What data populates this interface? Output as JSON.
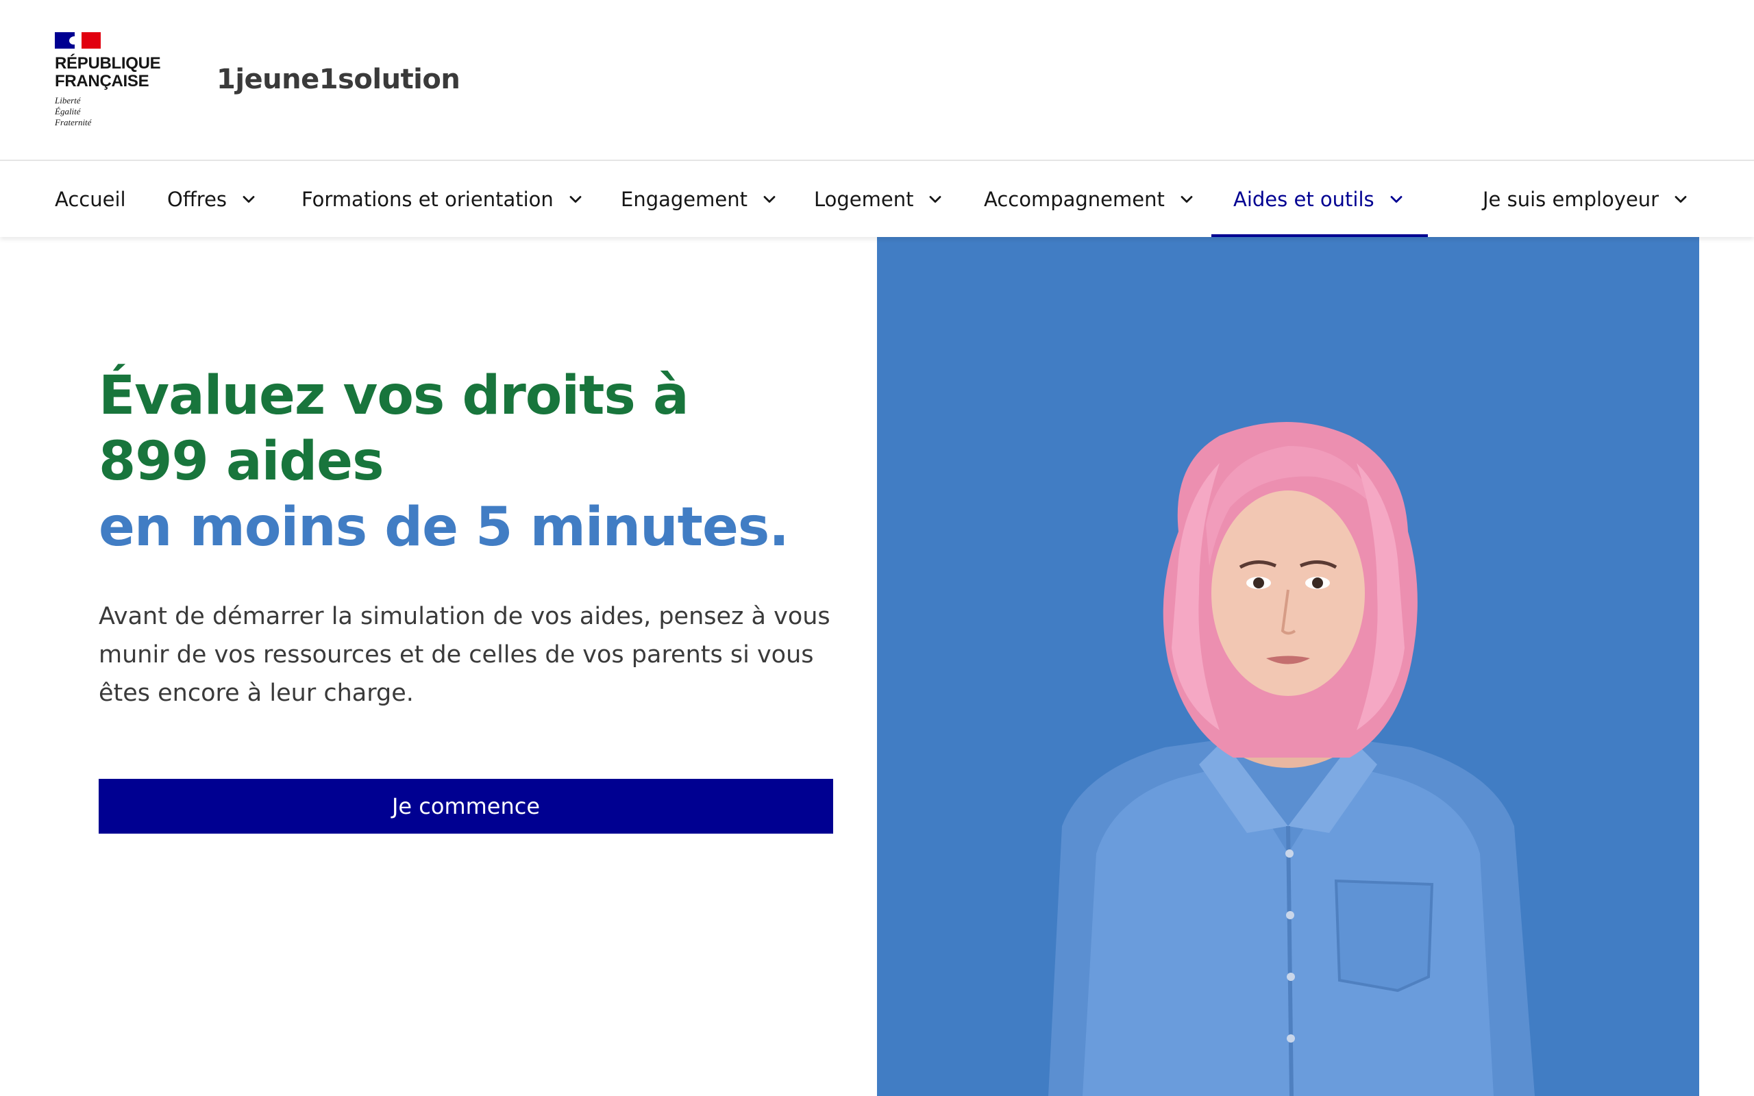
{
  "header": {
    "logo": {
      "name_line1": "RÉPUBLIQUE",
      "name_line2": "FRANÇAISE",
      "motto": [
        "Liberté",
        "Égalité",
        "Fraternité"
      ]
    },
    "site_title": "1jeune1solution"
  },
  "nav": {
    "items": [
      {
        "label": "Accueil",
        "has_menu": false
      },
      {
        "label": "Offres",
        "has_menu": true
      },
      {
        "label": "Formations et orientation",
        "has_menu": true
      },
      {
        "label": "Engagement",
        "has_menu": true
      },
      {
        "label": "Logement",
        "has_menu": true
      },
      {
        "label": "Accompagnement",
        "has_menu": true
      },
      {
        "label": "Aides et outils",
        "has_menu": true,
        "active": true
      },
      {
        "label": "Je suis employeur",
        "has_menu": true
      }
    ]
  },
  "hero": {
    "title_line1": "Évaluez vos droits à",
    "title_line2": "899 aides",
    "title_line3": "en moins de 5 minutes.",
    "description": "Avant de démarrer la simulation de vos aides, pensez à vous munir de vos ressources et de celles de vos parents si vous êtes encore à leur charge.",
    "cta_label": "Je commence",
    "image_icon": "portrait-photo"
  },
  "colors": {
    "primary": "#000091",
    "highlight_text": "#18753c",
    "highlight_bg": "#dffdf7",
    "accent_blue": "#417dc4",
    "flag_red": "#e1000f"
  }
}
